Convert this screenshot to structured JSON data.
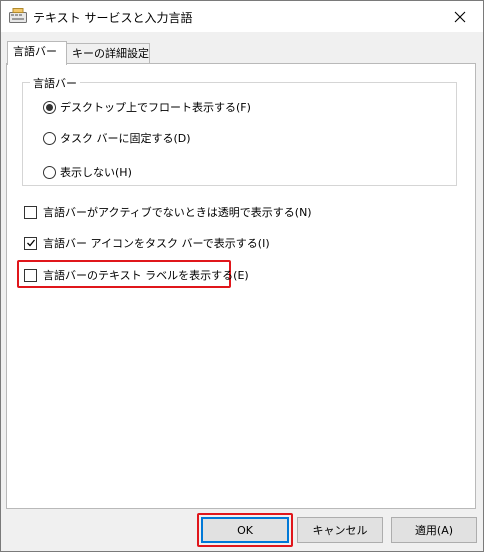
{
  "window": {
    "title": "テキスト サービスと入力言語"
  },
  "tabs": [
    {
      "label": "言語バー",
      "active": true
    },
    {
      "label": "キーの詳細設定",
      "active": false
    }
  ],
  "group": {
    "label": "言語バー",
    "options": [
      {
        "label": "デスクトップ上でフロート表示する(F)",
        "selected": true
      },
      {
        "label": "タスク バーに固定する(D)",
        "selected": false
      },
      {
        "label": "表示しない(H)",
        "selected": false
      }
    ]
  },
  "checkboxes": [
    {
      "label": "言語バーがアクティブでないときは透明で表示する(N)",
      "checked": false
    },
    {
      "label": "言語バー アイコンをタスク バーで表示する(I)",
      "checked": true
    },
    {
      "label": "言語バーのテキスト ラベルを表示する(E)",
      "checked": false
    }
  ],
  "buttons": {
    "ok": "OK",
    "cancel": "キャンセル",
    "apply": "適用(A)"
  },
  "colors": {
    "highlight": "#e0161b",
    "focus": "#0078d7"
  }
}
